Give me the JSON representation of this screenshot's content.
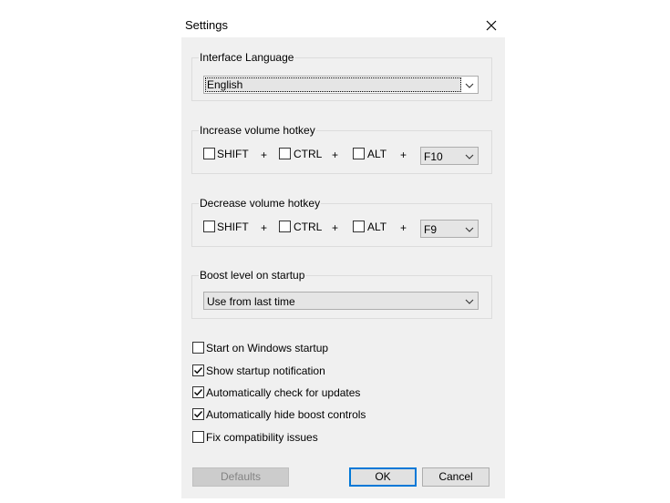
{
  "window": {
    "title": "Settings"
  },
  "language": {
    "label": "Interface Language",
    "value": "English"
  },
  "increase": {
    "label": "Increase volume hotkey",
    "shift": "SHIFT",
    "ctrl": "CTRL",
    "alt": "ALT",
    "plus": "+",
    "key": "F10",
    "shift_checked": false,
    "ctrl_checked": false,
    "alt_checked": false
  },
  "decrease": {
    "label": "Decrease volume hotkey",
    "shift": "SHIFT",
    "ctrl": "CTRL",
    "alt": "ALT",
    "plus": "+",
    "key": "F9",
    "shift_checked": false,
    "ctrl_checked": false,
    "alt_checked": false
  },
  "boost": {
    "label": "Boost level on startup",
    "value": "Use from last time"
  },
  "options": [
    {
      "label": "Start on Windows startup",
      "checked": false
    },
    {
      "label": "Show startup notification",
      "checked": true
    },
    {
      "label": "Automatically check for updates",
      "checked": true
    },
    {
      "label": "Automatically hide boost controls",
      "checked": true
    },
    {
      "label": "Fix compatibility issues",
      "checked": false
    }
  ],
  "buttons": {
    "defaults": "Defaults",
    "ok": "OK",
    "cancel": "Cancel"
  },
  "colors": {
    "accent": "#0078d7",
    "dialog_bg": "#f0f0f0",
    "combo_bg": "#e5e5e5"
  }
}
